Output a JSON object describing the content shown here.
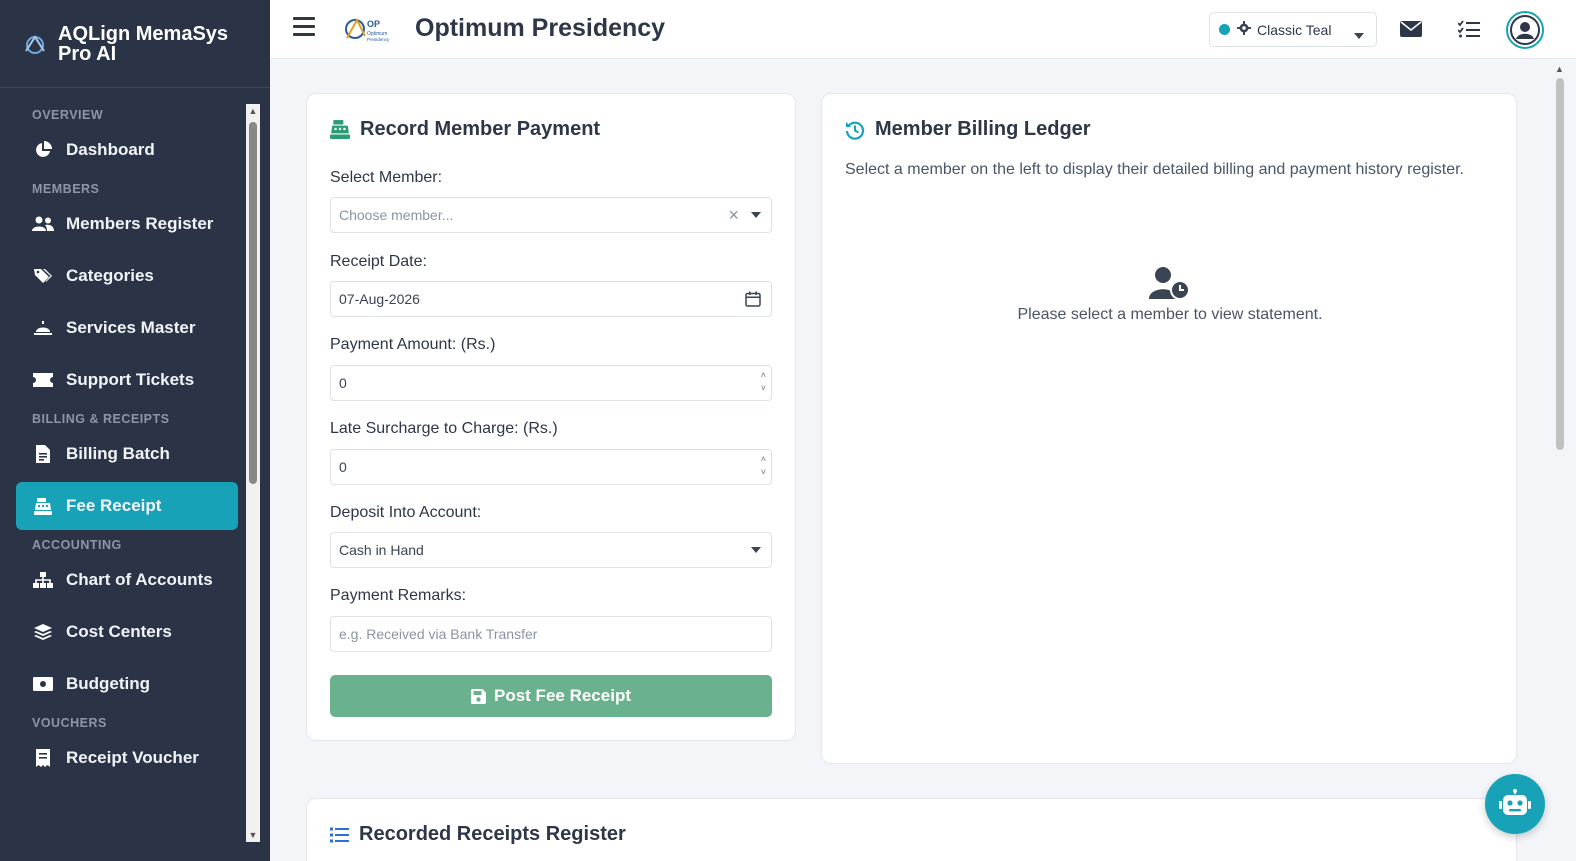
{
  "app": {
    "name": "AQLign MemaSys Pro AI"
  },
  "header": {
    "org_title": "Optimum Presidency",
    "theme": "Classic Teal"
  },
  "sidebar": {
    "sections": [
      {
        "label": "OVERVIEW",
        "items": [
          {
            "label": "Dashboard",
            "icon": "chart-pie-icon"
          }
        ]
      },
      {
        "label": "MEMBERS",
        "items": [
          {
            "label": "Members Register",
            "icon": "users-icon"
          },
          {
            "label": "Categories",
            "icon": "tags-icon"
          },
          {
            "label": "Services Master",
            "icon": "bell-concierge-icon"
          },
          {
            "label": "Support Tickets",
            "icon": "ticket-icon"
          }
        ]
      },
      {
        "label": "BILLING & RECEIPTS",
        "items": [
          {
            "label": "Billing Batch",
            "icon": "file-invoice-icon"
          },
          {
            "label": "Fee Receipt",
            "icon": "cash-register-icon",
            "active": true
          }
        ]
      },
      {
        "label": "ACCOUNTING",
        "items": [
          {
            "label": "Chart of Accounts",
            "icon": "sitemap-icon"
          },
          {
            "label": "Cost Centers",
            "icon": "layer-group-icon"
          },
          {
            "label": "Budgeting",
            "icon": "money-bill-icon"
          }
        ]
      },
      {
        "label": "VOUCHERS",
        "items": [
          {
            "label": "Receipt Voucher",
            "icon": "receipt-icon"
          }
        ]
      }
    ]
  },
  "payment_form": {
    "title": "Record Member Payment",
    "member_label": "Select Member:",
    "member_placeholder": "Choose member...",
    "date_label": "Receipt Date:",
    "date_value": "07-Aug-2026",
    "amount_label": "Payment Amount: (Rs.)",
    "amount_value": "0",
    "surcharge_label": "Late Surcharge to Charge: (Rs.)",
    "surcharge_value": "0",
    "account_label": "Deposit Into Account:",
    "account_value": "Cash in Hand",
    "remarks_label": "Payment Remarks:",
    "remarks_placeholder": "e.g. Received via Bank Transfer",
    "submit_label": "Post Fee Receipt"
  },
  "ledger": {
    "title": "Member Billing Ledger",
    "description": "Select a member on the left to display their detailed billing and payment history register.",
    "empty_message": "Please select a member to view statement."
  },
  "receipts_register": {
    "title": "Recorded Receipts Register"
  },
  "colors": {
    "accent": "#17a2b8",
    "sidebar_bg": "#2b3446",
    "submit_button": "#6ab18d"
  }
}
